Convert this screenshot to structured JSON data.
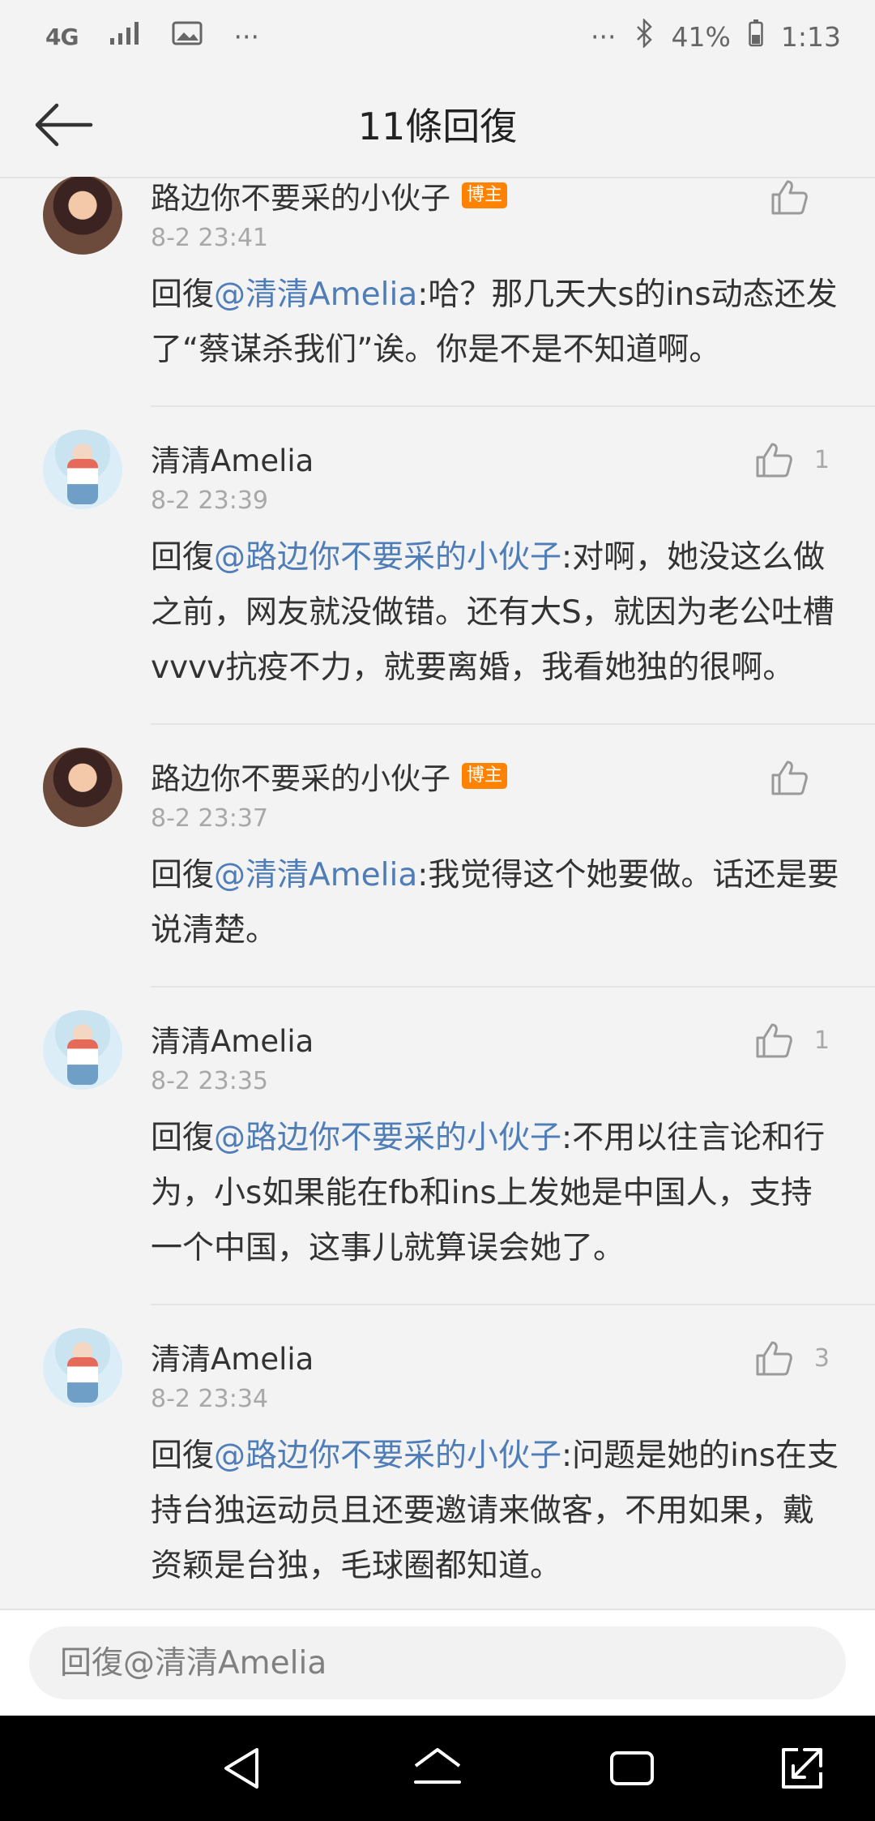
{
  "status_bar": {
    "network": "4G",
    "more": "···",
    "right_more": "···",
    "battery": "41%",
    "time": "1:13"
  },
  "header": {
    "title": "11條回復"
  },
  "comments": [
    {
      "author": "路边你不要采的小伙子",
      "badge": "博主",
      "time": "8-2 23:41",
      "likes": "",
      "reply_prefix": "回復",
      "mention": "@清清Amelia",
      "body": ":哈？那几天大s的ins动态还发了“蔡谋杀我们”诶。你是不是不知道啊。"
    },
    {
      "author": "清清Amelia",
      "badge": "",
      "time": "8-2 23:39",
      "likes": "1",
      "reply_prefix": "回復",
      "mention": "@路边你不要采的小伙子",
      "body": ":对啊，她没这么做之前，网友就没做错。还有大S，就因为老公吐槽vvvv抗疫不力，就要离婚，我看她独的很啊。"
    },
    {
      "author": "路边你不要采的小伙子",
      "badge": "博主",
      "time": "8-2 23:37",
      "likes": "",
      "reply_prefix": "回復",
      "mention": "@清清Amelia",
      "body": ":我觉得这个她要做。话还是要说清楚。"
    },
    {
      "author": "清清Amelia",
      "badge": "",
      "time": "8-2 23:35",
      "likes": "1",
      "reply_prefix": "回復",
      "mention": "@路边你不要采的小伙子",
      "body": ":不用以往言论和行为，小s如果能在fb和ins上发她是中国人，支持一个中国，这事儿就算误会她了。"
    },
    {
      "author": "清清Amelia",
      "badge": "",
      "time": "8-2 23:34",
      "likes": "3",
      "reply_prefix": "回復",
      "mention": "@路边你不要采的小伙子",
      "body": ":问题是她的ins在支持台独运动员且还要邀请来做客，不用如果，戴资颖是台独，毛球圈都知道。"
    }
  ],
  "reply_input": {
    "placeholder": "回復@清清Amelia"
  },
  "colors": {
    "mention": "#4f7db7",
    "badge": "#ff8200",
    "background": "#f3f3f3",
    "muted_text": "#a8a8a8"
  }
}
